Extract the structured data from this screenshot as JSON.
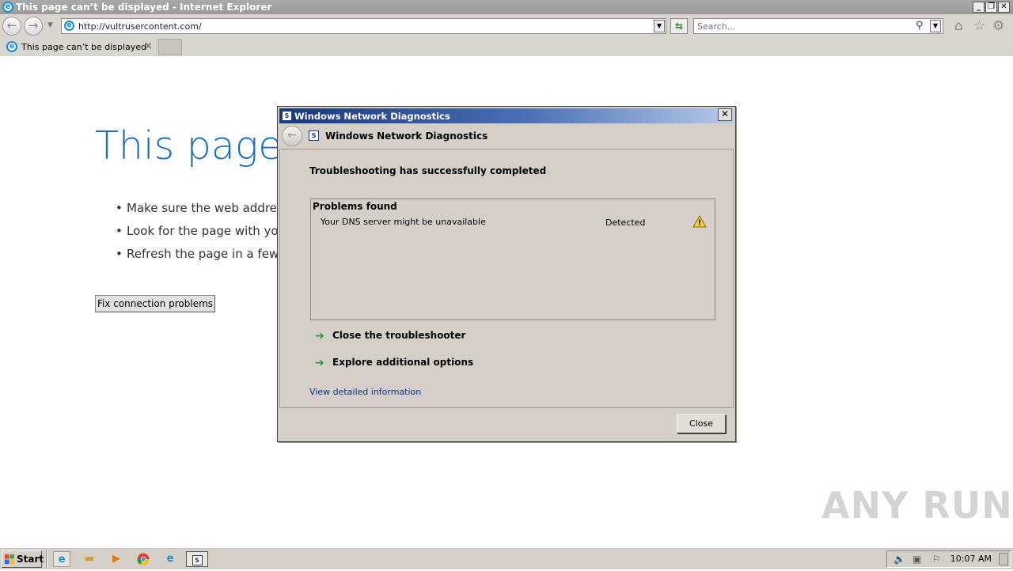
{
  "browser": {
    "window_title": "This page can’t be displayed - Internet Explorer",
    "address_url": "http://vultrusercontent.com/",
    "search_placeholder": "Search...",
    "tab_label": "This page can’t be displayed",
    "tab_close": "×"
  },
  "page": {
    "title": "This page c",
    "bullets": [
      "Make sure the web address h",
      "Look for the page with your",
      "Refresh the page in a few mi"
    ],
    "fix_button": "Fix connection problems"
  },
  "dialog": {
    "window_title": "Windows Network Diagnostics",
    "header_title": "Windows Network Diagnostics",
    "status": "Troubleshooting has successfully completed",
    "problems_header": "Problems found",
    "problem": {
      "text": "Your DNS server might be unavailable",
      "status": "Detected"
    },
    "actions": [
      "Close the troubleshooter",
      "Explore additional options"
    ],
    "detail_link": "View detailed information",
    "close_button": "Close"
  },
  "watermark": "ANY RUN",
  "taskbar": {
    "start_label": "Start",
    "clock": "10:07 AM"
  },
  "colors": {
    "title_blue": "#1f6fbf",
    "dialog_title_start": "#17387a",
    "link_blue": "#0b2a9c",
    "action_arrow_green": "#1f9e3a"
  }
}
